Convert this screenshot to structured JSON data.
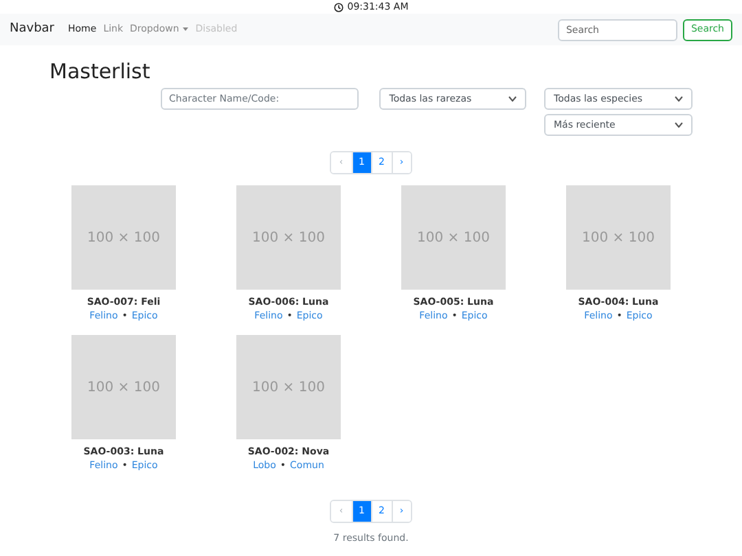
{
  "clock": {
    "time": "09:31:43 AM"
  },
  "navbar": {
    "brand": "Navbar",
    "links": [
      {
        "label": "Home",
        "kind": "active"
      },
      {
        "label": "Link",
        "kind": "link"
      },
      {
        "label": "Dropdown",
        "kind": "dropdown"
      },
      {
        "label": "Disabled",
        "kind": "disabled"
      }
    ],
    "search": {
      "placeholder": "Search",
      "button": "Search"
    }
  },
  "title": "Masterlist",
  "filters": {
    "name": {
      "placeholder": "Character Name/Code:"
    },
    "rarity": {
      "value": "Todas las rarezas"
    },
    "species": {
      "value": "Todas las especies"
    },
    "sort": {
      "value": "Más reciente"
    }
  },
  "pagination_top": [
    {
      "label": "‹",
      "kind": "prev",
      "selected": false
    },
    {
      "label": "1",
      "kind": "page",
      "selected": true
    },
    {
      "label": "2",
      "kind": "page",
      "selected": false
    },
    {
      "label": "›",
      "kind": "next",
      "selected": false
    }
  ],
  "characters": [
    {
      "image_label": "100 × 100",
      "name": "SAO-007: Feli",
      "species": "Felino",
      "separator": "•",
      "rarity": "Epico"
    },
    {
      "image_label": "100 × 100",
      "name": "SAO-006: Luna",
      "species": "Felino",
      "separator": "•",
      "rarity": "Epico"
    },
    {
      "image_label": "100 × 100",
      "name": "SAO-005: Luna",
      "species": "Felino",
      "separator": "•",
      "rarity": "Epico"
    },
    {
      "image_label": "100 × 100",
      "name": "SAO-004: Luna",
      "species": "Felino",
      "separator": "•",
      "rarity": "Epico"
    },
    {
      "image_label": "100 × 100",
      "name": "SAO-003: Luna",
      "species": "Felino",
      "separator": "•",
      "rarity": "Epico"
    },
    {
      "image_label": "100 × 100",
      "name": "SAO-002: Nova",
      "species": "Lobo",
      "separator": "•",
      "rarity": "Comun"
    }
  ],
  "pagination_bottom": [
    {
      "label": "‹",
      "kind": "prev",
      "selected": false
    },
    {
      "label": "1",
      "kind": "page",
      "selected": true
    },
    {
      "label": "2",
      "kind": "page",
      "selected": false
    },
    {
      "label": "›",
      "kind": "next",
      "selected": false
    }
  ],
  "results": "7 results found."
}
